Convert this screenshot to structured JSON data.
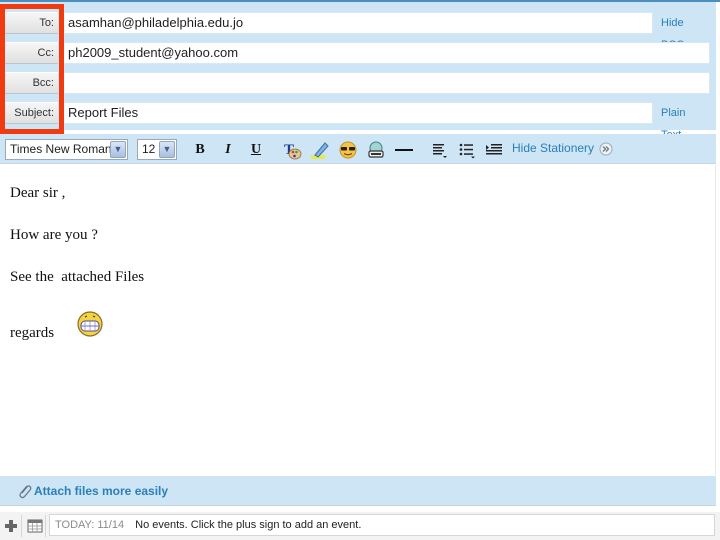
{
  "compose": {
    "to": {
      "label": "To:",
      "value": "asamhan@philadelphia.edu.jo"
    },
    "cc": {
      "label": "Cc:",
      "value": "ph2009_student@yahoo.com"
    },
    "bcc": {
      "label": "Bcc:",
      "value": ""
    },
    "subject": {
      "label": "Subject:",
      "value": "Report Files"
    },
    "hide_bcc_link": "Hide BCC",
    "plain_text_link": "Plain Text"
  },
  "toolbar": {
    "font_family": "Times New Roman",
    "font_size": "12",
    "bold_label": "B",
    "italic_label": "I",
    "underline_label": "U",
    "icons": [
      "text-color-icon",
      "highlight-icon",
      "emoticon-icon",
      "insert-image-icon",
      "horizontal-rule-icon",
      "align-icon",
      "bullet-list-icon",
      "indent-icon"
    ],
    "hide_stationery_label": "Hide Stationery"
  },
  "message_body": {
    "lines": [
      "Dear sir ,",
      "How are you ?",
      "See the  attached Files",
      "regards"
    ],
    "emoticon": "big-grin-emoticon"
  },
  "attach": {
    "label": "Attach files more easily"
  },
  "calendar": {
    "today_label": "TODAY: 11/14",
    "events_text": "No events. Click the plus sign to add an event."
  },
  "colors": {
    "header_bg": "#cde5f4",
    "link": "#2b7fb8",
    "highlight_frame": "#f03a10"
  }
}
